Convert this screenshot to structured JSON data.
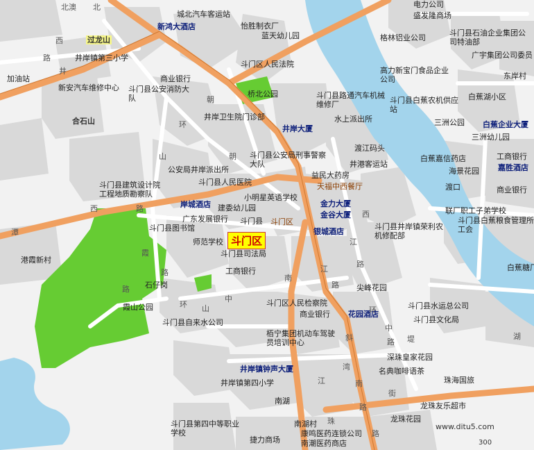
{
  "map": {
    "colors": {
      "background": "#f2f2f2",
      "block": "#d9d9d9",
      "river": "#a3d4ec",
      "park": "#66cc33",
      "arterial": "#f0a060",
      "road": "#ffffff"
    },
    "district_label": "斗门区",
    "watermark": "www.ditu5.com",
    "scale_label": "300",
    "places": {
      "chengbei_bus": "城北汽车客运站",
      "xinhongda_hotel": "新鸿大酒店",
      "yizhi_clothing": "怡胜制衣厂",
      "lantian_kinder": "蓝天幼儿园",
      "gelin_aluminum": "格林铝业公司",
      "power_supply": "电力公司",
      "shengfa_mall": "盛发隆商场",
      "guolongshan": "过龙山",
      "jingan_school3": "井岸镇第三小学",
      "jiayouzhan": "加油站",
      "xinan_repair": "新安汽车维修中心",
      "commercial_bank1": "商业银行",
      "fire_brigade": "斗门县公安消防大队",
      "district_court": "斗门区人民法院",
      "shiyou_group": "斗门县石油企业集团公司特油部",
      "gaoli_food": "高力新宝门食品企业公司",
      "guangye_group": "广宇集团公司委员",
      "dongan_village": "东岸村",
      "qiaobei_park": "桥北公园",
      "road_repair": "斗门县路通汽车机械维修厂",
      "baijiao_farm": "斗门县白蕉农机供应站",
      "baijiao_lake": "白蕉湖小区",
      "hexi_shan": "合石山",
      "clinic": "井岸卫生院门诊部",
      "jingan_tower": "井岸大厦",
      "shuishang_police": "水上派出所",
      "sanzhou_park": "三洲公园",
      "baijiao_tower": "白蕉企业大厦",
      "sanzhou_kinder": "三洲幼儿园",
      "ferry_pier": "渡江码头",
      "criminal_police": "斗门县公安局刑事警察大队",
      "jinggang_bus": "井港客运站",
      "baijiao_trust": "白蕉嘉信药店",
      "commercial_bank_e": "工商银行",
      "jiasheng_hotel": "嘉胜酒店",
      "haiyi_garden": "海景花园",
      "police_station": "公安局井岸派出所",
      "yimin_pharmacy": "益民大药房",
      "bus_station2": "天福中西餐厅",
      "ferry": "渡口",
      "commercial_bank_r": "商业银行",
      "design_institute": "斗门县建筑设计院工程地质勘察队",
      "people_hospital": "斗门县人民医院",
      "xiaomingxing_school": "小明星英语学校",
      "jinli_tower": "金力大厦",
      "anche_hotel": "岸城酒店",
      "jiyu_kinder": "建委幼儿园",
      "jingu_tower": "金谷大厦",
      "labor_school": "联厂职工子弟学校",
      "baijiao_grain": "斗门县白蕉粮食管理所工会",
      "guangdong_bank": "广东发展银行",
      "doumen_county": "斗门县",
      "doumen_district": "斗门区",
      "library": "斗门县图书馆",
      "yincheng_hotel": "银城酒店",
      "jingan_repair": "斗门县井岸镇荣利农机修配部",
      "normal_school": "师范学校",
      "court2": "斗门县司法局",
      "gangwan_village": "港霞新村",
      "icbc": "工商银行",
      "shizai_mountain": "石仔岗",
      "jiaotou_park": "尖峰花园",
      "procurator": "斗门区人民检察院",
      "commercial_bank_m": "商业银行",
      "garden_hotel": "花园酒店",
      "shuiyun": "斗门县水运总公司",
      "culture_bureau": "斗门县文化局",
      "xiashan_park": "霞山公园",
      "zilai_water": "斗门县自来水公司",
      "baijiao_sugar": "白蕉糖厂",
      "bainiao_group": "栢宁集团机动车驾驶员培训中心",
      "shenzhen_garden": "深珠皇家花园",
      "jingan_tower2": "井岸镇钟声大厦",
      "mingdian_coffee": "名典咖啡语茶",
      "zhuhai_intl": "珠海国旅",
      "jingan_school4": "井岸镇第四小学",
      "nanyi": "南湖",
      "longzhu_market": "龙珠友乐超市",
      "longzhu_garden": "龙珠花园",
      "no4_school": "斗门县第四中等职业学校",
      "nanhu_village": "南湖村",
      "kangming_pharmacy": "康鸣医药连锁公司",
      "nanchao_pharmacy": "南潮医药商店",
      "jieli_market": "捷力商场"
    },
    "roads": {
      "beiao": "北澳",
      "bei_lu": "北",
      "xilu1": "西",
      "lu1": "路",
      "jingan_road_l": "井",
      "zhu": "朝",
      "huan1": "环",
      "shan1": "山",
      "chao2": "朝",
      "xi_road": "西",
      "lu2": "路",
      "tan": "潭",
      "xia": "霞",
      "xia_road": "路",
      "lu_s": "路",
      "huan_s": "环",
      "shan_s": "山",
      "zhong": "中",
      "nan": "南",
      "jiang": "江",
      "lu_c": "路",
      "xi_r": "西",
      "jiang_r": "江",
      "lu_r": "路",
      "huan_r": "环",
      "zhong_r": "中",
      "di": "堤",
      "lu_e": "路",
      "hu": "湖",
      "xie": "斜",
      "jiang_s": "江",
      "nan_s": "南",
      "wan": "湾",
      "lu_ss": "路",
      "zhu_n": "珠",
      "lu_n": "路",
      "jie": "街"
    }
  }
}
